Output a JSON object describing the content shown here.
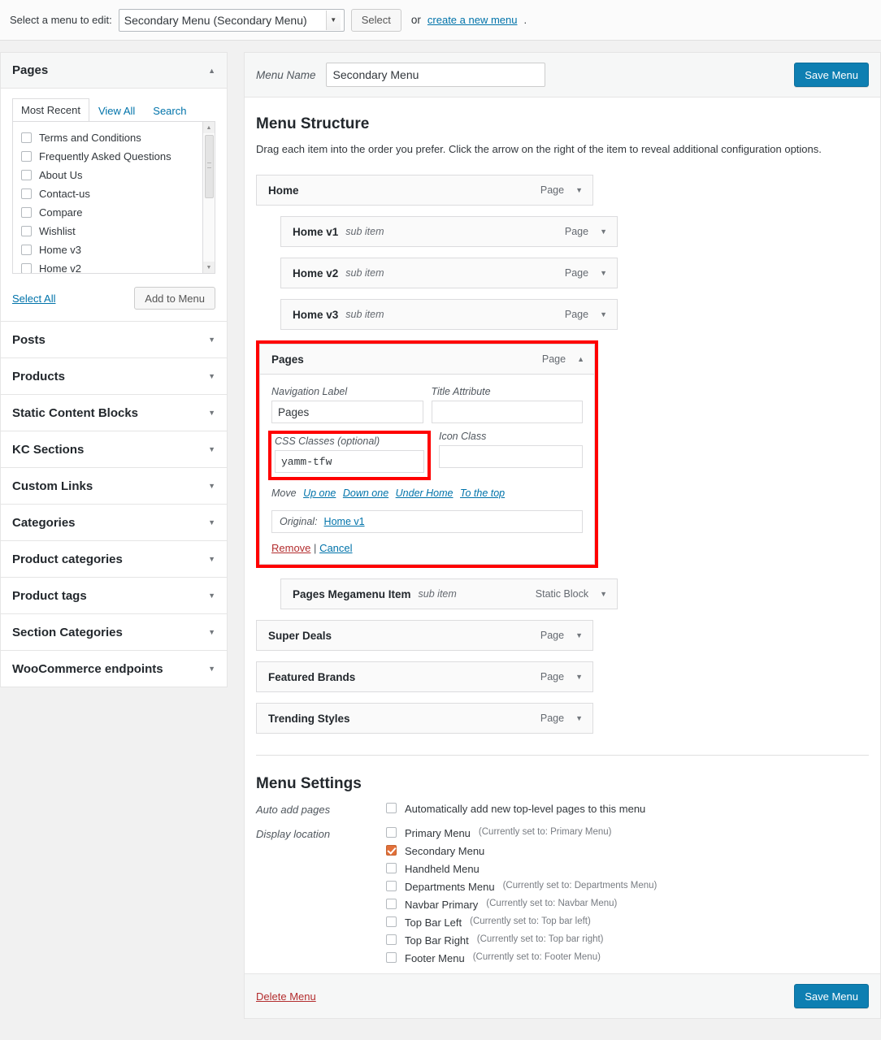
{
  "topbar": {
    "label": "Select a menu to edit:",
    "selected_menu": "Secondary Menu (Secondary Menu)",
    "select_button": "Select",
    "or_text": "or",
    "create_link": "create a new menu",
    "period": "."
  },
  "sidebar": {
    "pages_panel": {
      "title": "Pages",
      "tabs": [
        {
          "label": "Most Recent",
          "active": true
        },
        {
          "label": "View All",
          "active": false
        },
        {
          "label": "Search",
          "active": false
        }
      ],
      "items": [
        {
          "label": "Terms and Conditions",
          "checked": false
        },
        {
          "label": "Frequently Asked Questions",
          "checked": false
        },
        {
          "label": "About Us",
          "checked": false
        },
        {
          "label": "Contact-us",
          "checked": false
        },
        {
          "label": "Compare",
          "checked": false
        },
        {
          "label": "Wishlist",
          "checked": false
        },
        {
          "label": "Home v3",
          "checked": false
        },
        {
          "label": "Home v2",
          "checked": false
        }
      ],
      "select_all": "Select All",
      "add_to_menu": "Add to Menu"
    },
    "accordions": [
      {
        "label": "Posts"
      },
      {
        "label": "Products"
      },
      {
        "label": "Static Content Blocks"
      },
      {
        "label": "KC Sections"
      },
      {
        "label": "Custom Links"
      },
      {
        "label": "Categories"
      },
      {
        "label": "Product categories"
      },
      {
        "label": "Product tags"
      },
      {
        "label": "Section Categories"
      },
      {
        "label": "WooCommerce endpoints"
      }
    ]
  },
  "main": {
    "menu_name_label": "Menu Name",
    "menu_name_value": "Secondary Menu",
    "save_menu": "Save Menu",
    "structure_title": "Menu Structure",
    "structure_hint": "Drag each item into the order you prefer. Click the arrow on the right of the item to reveal additional configuration options.",
    "rows_top": [
      {
        "title": "Home",
        "sub": "",
        "type": "Page",
        "indent": false
      },
      {
        "title": "Home v1",
        "sub": "sub item",
        "type": "Page",
        "indent": true
      },
      {
        "title": "Home v2",
        "sub": "sub item",
        "type": "Page",
        "indent": true
      },
      {
        "title": "Home v3",
        "sub": "sub item",
        "type": "Page",
        "indent": true
      }
    ],
    "expanded": {
      "title": "Pages",
      "type": "Page",
      "nav_label_label": "Navigation Label",
      "nav_label_value": "Pages",
      "title_attr_label": "Title Attribute",
      "title_attr_value": "",
      "css_label": "CSS Classes (optional)",
      "css_value": "yamm-tfw",
      "icon_label": "Icon Class",
      "icon_value": "",
      "move_label": "Move",
      "move_links": [
        "Up one",
        "Down one",
        "Under Home",
        "To the top"
      ],
      "original_label": "Original:",
      "original_value": "Home v1",
      "remove": "Remove",
      "separator": "|",
      "cancel": "Cancel"
    },
    "rows_bottom": [
      {
        "title": "Pages Megamenu Item",
        "sub": "sub item",
        "type": "Static Block",
        "indent": true
      },
      {
        "title": "Super Deals",
        "sub": "",
        "type": "Page",
        "indent": false
      },
      {
        "title": "Featured Brands",
        "sub": "",
        "type": "Page",
        "indent": false
      },
      {
        "title": "Trending Styles",
        "sub": "",
        "type": "Page",
        "indent": false
      }
    ],
    "settings": {
      "title": "Menu Settings",
      "auto_add_label": "Auto add pages",
      "auto_add_option": {
        "label": "Automatically add new top-level pages to this menu",
        "checked": false
      },
      "display_location_label": "Display location",
      "locations": [
        {
          "label": "Primary Menu",
          "note": "(Currently set to: Primary Menu)",
          "checked": false
        },
        {
          "label": "Secondary Menu",
          "note": "",
          "checked": true
        },
        {
          "label": "Handheld Menu",
          "note": "",
          "checked": false
        },
        {
          "label": "Departments Menu",
          "note": "(Currently set to: Departments Menu)",
          "checked": false
        },
        {
          "label": "Navbar Primary",
          "note": "(Currently set to: Navbar Menu)",
          "checked": false
        },
        {
          "label": "Top Bar Left",
          "note": "(Currently set to: Top bar left)",
          "checked": false
        },
        {
          "label": "Top Bar Right",
          "note": "(Currently set to: Top bar right)",
          "checked": false
        },
        {
          "label": "Footer Menu",
          "note": "(Currently set to: Footer Menu)",
          "checked": false
        }
      ]
    },
    "footer": {
      "delete_menu": "Delete Menu",
      "save_menu": "Save Menu"
    }
  },
  "colors": {
    "accent_blue": "#0e7fb2",
    "link_blue": "#0073aa",
    "highlight_red": "#ff0000",
    "checkbox_orange": "#e2703a",
    "danger_red": "#b32d2e"
  }
}
